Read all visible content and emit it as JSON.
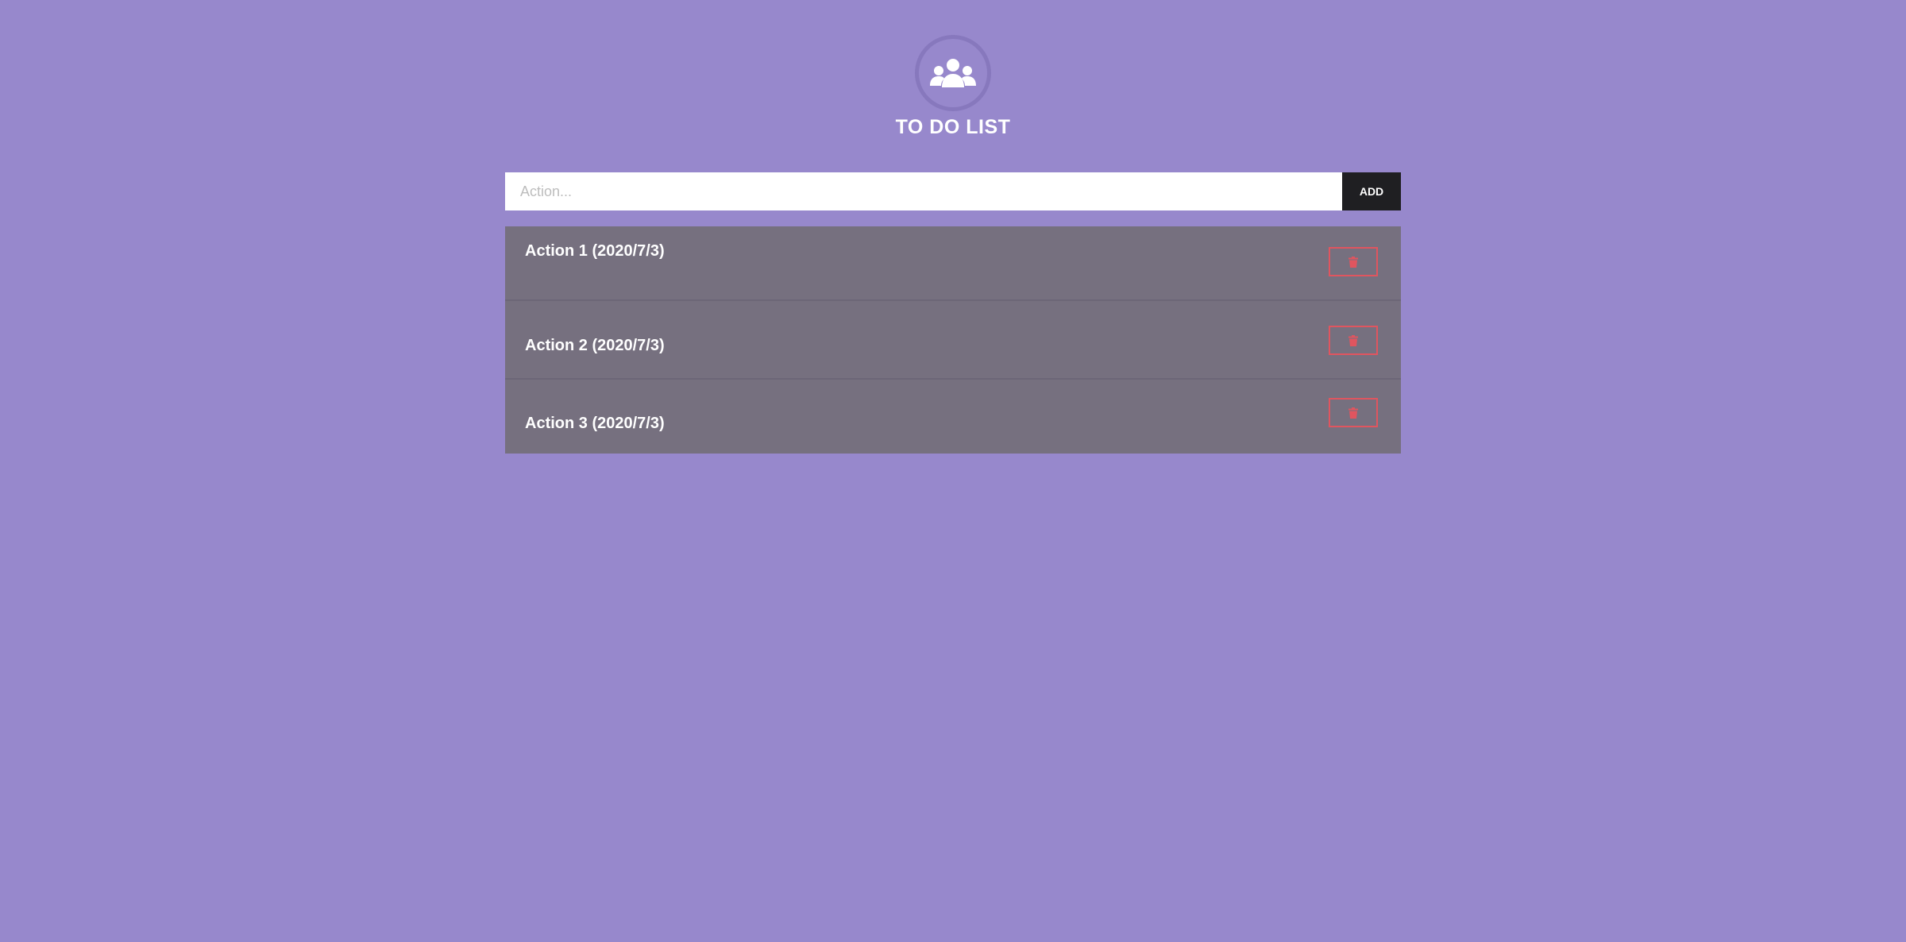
{
  "header": {
    "title": "TO DO LIST",
    "logo_icon": "users-icon"
  },
  "form": {
    "input_placeholder": "Action...",
    "input_value": "",
    "add_label": "ADD"
  },
  "todos": [
    {
      "text": "Action 1 (2020/7/3)",
      "delete_icon": "trash-icon"
    },
    {
      "text": "Action 2 (2020/7/3)",
      "delete_icon": "trash-icon"
    },
    {
      "text": "Action 3 (2020/7/3)",
      "delete_icon": "trash-icon"
    }
  ],
  "colors": {
    "background": "#9788cc",
    "list_background": "#76707f",
    "add_button": "#1f1f22",
    "delete_accent": "#e0555f",
    "text": "#ffffff"
  }
}
